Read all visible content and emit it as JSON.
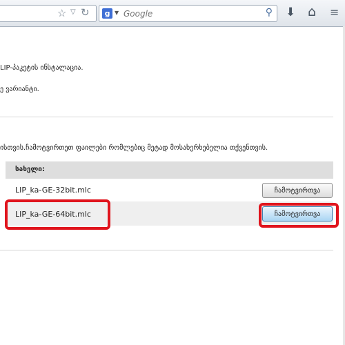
{
  "browser": {
    "search_placeholder": "Google",
    "search_engine_letter": "g",
    "icons": [
      "bookmark-star-icon",
      "dropdown-icon",
      "reload-icon",
      "search-engine-icon",
      "magnifier-icon",
      "download-icon",
      "home-icon",
      "menu-icon"
    ]
  },
  "content": {
    "line1": "LIP-პაკეტის ინსტალაცია.",
    "line2": "ე ვარიანტი.",
    "line3": "ისთვის.ჩამოტვირთეთ ფაილები რომლებიც მეტად მოსახერხებელია თქვენთვის.",
    "table_header": "სახელი:",
    "rows": [
      {
        "file": "LIP_ka-GE-32bit.mlc",
        "button": "ჩამოტვირთვა"
      },
      {
        "file": "LIP_ka-GE-64bit.mlc",
        "button": "ჩამოტვირთვა"
      }
    ]
  },
  "colors": {
    "highlight": "#e0141d",
    "selected_button": "#a9d5f3"
  }
}
